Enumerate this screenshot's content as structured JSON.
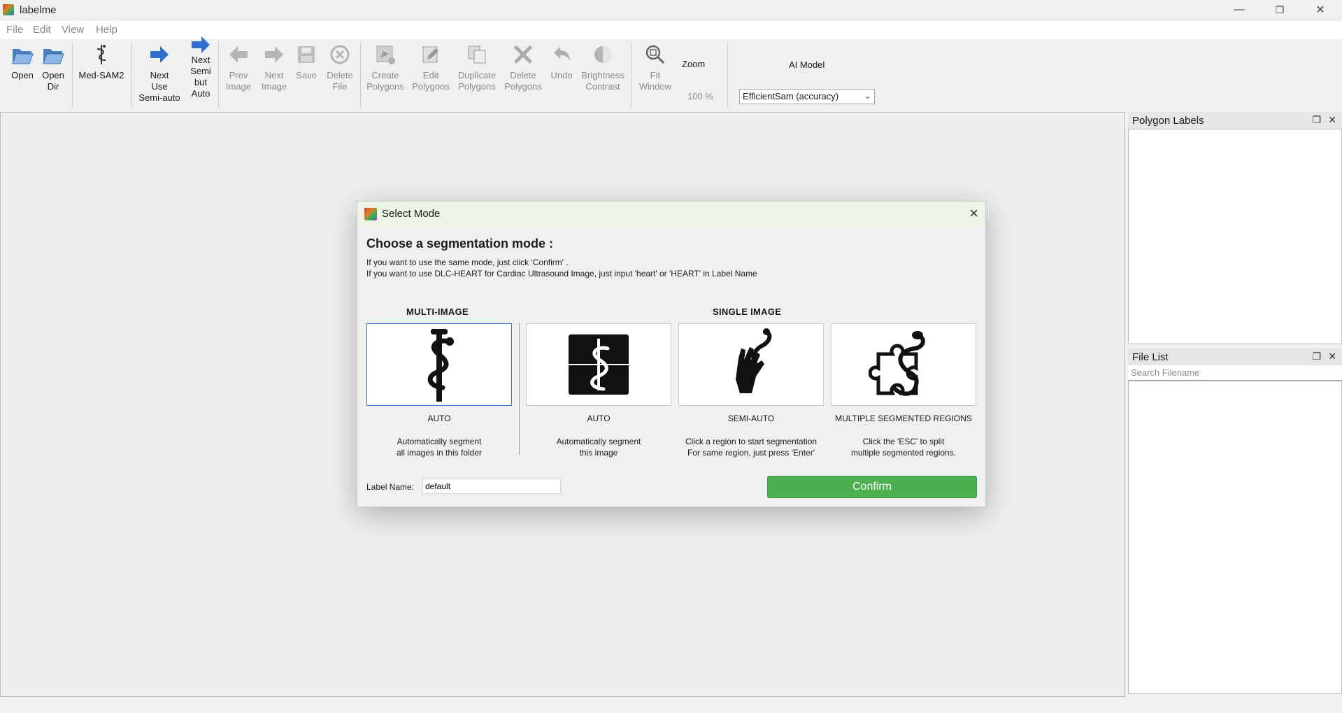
{
  "window": {
    "title": "labelme",
    "minimize": "—",
    "maximize": "❐",
    "close": "✕"
  },
  "menu": [
    "File",
    "Edit",
    "View",
    "Help"
  ],
  "toolbar": {
    "open": "Open",
    "open_dir": [
      "Open",
      "Dir"
    ],
    "med_sam2": "Med-SAM2",
    "next_use_semi": [
      "Next",
      "Use",
      "Semi-auto"
    ],
    "next_semi_auto": [
      "Next",
      "Semi",
      "but",
      "Auto"
    ],
    "prev_image": [
      "Prev",
      "Image"
    ],
    "next_image": [
      "Next",
      "Image"
    ],
    "save": "Save",
    "delete_file": [
      "Delete",
      "File"
    ],
    "create_polygons": [
      "Create",
      "Polygons"
    ],
    "edit_polygons": [
      "Edit",
      "Polygons"
    ],
    "duplicate_polygons": [
      "Duplicate",
      "Polygons"
    ],
    "delete_polygons": [
      "Delete",
      "Polygons"
    ],
    "undo": "Undo",
    "brightness_contrast": [
      "Brightness",
      "Contrast"
    ],
    "fit_window": [
      "Fit",
      "Window"
    ],
    "zoom_label": "Zoom",
    "zoom_value": "100 %",
    "ai_model_label": "AI Model",
    "ai_model_value": "EfficientSam (accuracy)"
  },
  "panels": {
    "polygon_labels": {
      "title": "Polygon Labels"
    },
    "file_list": {
      "title": "File List",
      "search_placeholder": "Search Filename"
    }
  },
  "dialog": {
    "title": "Select Mode",
    "heading": "Choose a segmentation mode :",
    "line1": "If you want to use the same mode, just click 'Confirm' .",
    "line2": "If you want to use DLC-HEART for Cardiac Ultrasound Image, just input 'heart' or 'HEART' in Label Name",
    "multi_title": "MULTI-IMAGE",
    "single_title": "SINGLE IMAGE",
    "modes": [
      {
        "label": "AUTO",
        "desc": [
          "Automatically segment",
          "all images in this folder"
        ],
        "icon": "caduceus-icon",
        "selected": true
      },
      {
        "label": "AUTO",
        "desc": [
          "Automatically segment",
          "this image"
        ],
        "icon": "square-caduceus-icon",
        "selected": false
      },
      {
        "label": "SEMI-AUTO",
        "desc": [
          "Click a region to start segmentation",
          "For same region, just press 'Enter'"
        ],
        "icon": "hand-snake-icon",
        "selected": false
      },
      {
        "label": "MULTIPLE SEGMENTED REGIONS",
        "desc": [
          "Click the 'ESC' to split",
          "multiple segmented regions."
        ],
        "icon": "puzzle-snake-icon",
        "selected": false
      }
    ],
    "label_name_label": "Label Name:",
    "label_name_value": "default",
    "confirm": "Confirm"
  },
  "colors": {
    "accent_green": "#4cae4f",
    "selected_border": "#2f7ad8",
    "arrow_blue": "#2f6fd0"
  }
}
